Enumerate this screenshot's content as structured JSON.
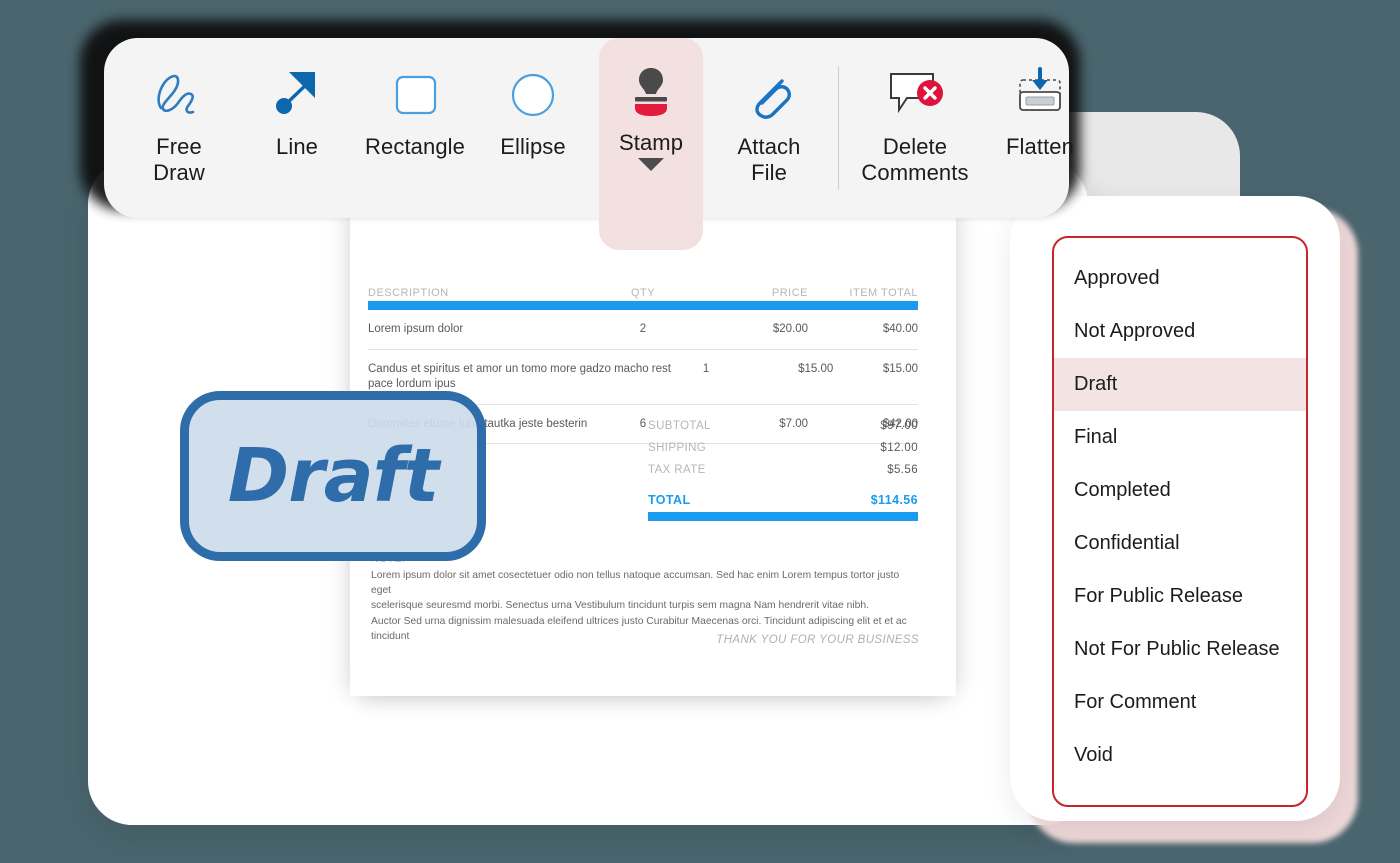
{
  "toolbar": {
    "items": [
      {
        "label": "Free\nDraw",
        "icon": "free-draw-icon",
        "name": "free-draw",
        "active": false
      },
      {
        "label": "Line",
        "icon": "line-arrow-icon",
        "name": "line",
        "active": false
      },
      {
        "label": "Rectangle",
        "icon": "rectangle-icon",
        "name": "rectangle",
        "active": false
      },
      {
        "label": "Ellipse",
        "icon": "ellipse-icon",
        "name": "ellipse",
        "active": false
      },
      {
        "label": "Stamp",
        "icon": "stamp-icon",
        "name": "stamp",
        "active": true
      },
      {
        "label": "Attach\nFile",
        "icon": "paperclip-icon",
        "name": "attach-file",
        "active": false
      },
      {
        "label": "Delete\nComments",
        "icon": "delete-comment-icon",
        "name": "delete-comments",
        "active": false
      },
      {
        "label": "Flatten",
        "icon": "flatten-icon",
        "name": "flatten",
        "active": false
      }
    ],
    "labels": {
      "free_draw": "Free\nDraw",
      "line": "Line",
      "rectangle": "Rectangle",
      "ellipse": "Ellipse",
      "stamp": "Stamp",
      "attach_file": "Attach\nFile",
      "delete_comments": "Delete\nComments",
      "flatten": "Flatten"
    }
  },
  "stamp_menu": {
    "selected": "Draft",
    "items": [
      "Approved",
      "Not Approved",
      "Draft",
      "Final",
      "Completed",
      "Confidential",
      "For Public Release",
      "Not For Public Release",
      "For Comment",
      "Void"
    ]
  },
  "stamp_overlay": {
    "text": "Draft",
    "border_color": "#2f6daa",
    "fill_color": "#cddcec"
  },
  "document": {
    "table": {
      "headers": [
        "DESCRIPTION",
        "QTY",
        "PRICE",
        "ITEM TOTAL"
      ],
      "rows": [
        {
          "description": "Lorem ipsum dolor",
          "qty": "2",
          "price": "$20.00",
          "total": "$40.00"
        },
        {
          "description": "Candus et spiritus et amor un tomo more gadzo macho rest pace lordum ipus",
          "qty": "1",
          "price": "$15.00",
          "total": "$15.00"
        },
        {
          "description": "Doromites etume tuna tautka jeste besterin",
          "qty": "6",
          "price": "$7.00",
          "total": "$42.00"
        }
      ]
    },
    "totals": [
      {
        "label": "SUBTOTAL",
        "value": "$97.00"
      },
      {
        "label": "SHIPPING",
        "value": "$12.00"
      },
      {
        "label": "TAX RATE",
        "value": "$5.56"
      }
    ],
    "grand_total": {
      "label": "TOTAL",
      "value": "$114.56"
    },
    "note": {
      "title": "NOTE:",
      "lines": [
        "Lorem ipsum dolor sit amet cosectetuer odio non tellus natoque accumsan. Sed hac enim Lorem tempus tortor justo eget",
        "scelerisque seuresmd morbi. Senectus urna Vestibulum tincidunt turpis sem magna Nam hendrerit vitae nibh.",
        "Auctor Sed urna dignissim malesuada eleifend ultrices justo Curabitur Maecenas orci. Tincidunt adipiscing elit et et ac tincidunt"
      ]
    },
    "footer": "THANK YOU FOR YOUR BUSINESS"
  },
  "colors": {
    "accent_blue": "#1b9bf0",
    "menu_border_red": "#c9232d",
    "highlight_pink": "#f3e3e3",
    "stamp_red": "#e31b3d"
  }
}
